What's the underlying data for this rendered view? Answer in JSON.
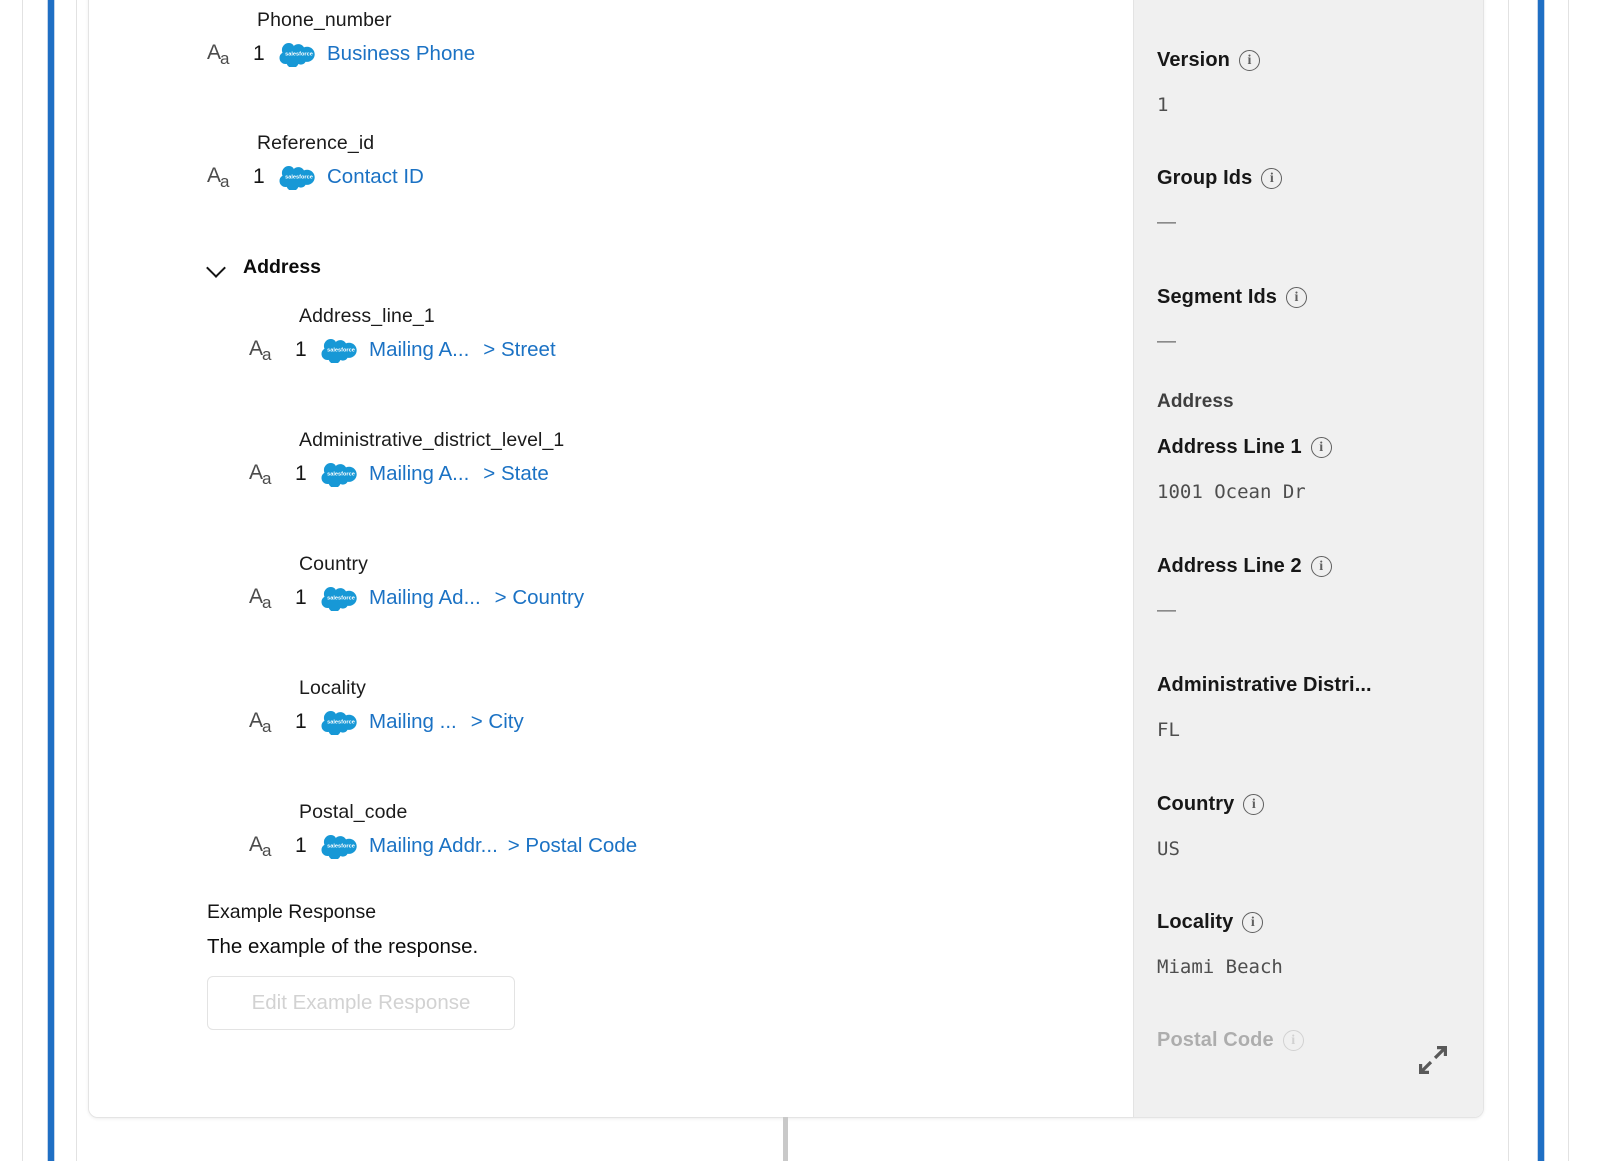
{
  "mapping_pane": {
    "fields": [
      {
        "name": "Phone_number",
        "type_icon": "text-type-icon",
        "count": "1",
        "source_icon": "salesforce-icon",
        "source": "Business Phone",
        "sub": ""
      },
      {
        "name": "Reference_id",
        "type_icon": "text-type-icon",
        "count": "1",
        "source_icon": "salesforce-icon",
        "source": "Contact ID",
        "sub": ""
      }
    ],
    "group": {
      "label": "Address",
      "expanded": true,
      "chevron_icon": "chevron-down-icon",
      "fields": [
        {
          "name": "Address_line_1",
          "count": "1",
          "source_icon": "salesforce-icon",
          "source": "Mailing A...",
          "sub": "> Street"
        },
        {
          "name": "Administrative_district_level_1",
          "count": "1",
          "source_icon": "salesforce-icon",
          "source": "Mailing A...",
          "sub": "> State"
        },
        {
          "name": "Country",
          "count": "1",
          "source_icon": "salesforce-icon",
          "source": "Mailing Ad...",
          "sub": "> Country"
        },
        {
          "name": "Locality",
          "count": "1",
          "source_icon": "salesforce-icon",
          "source": "Mailing ...",
          "sub": "> City"
        },
        {
          "name": "Postal_code",
          "count": "1",
          "source_icon": "salesforce-icon",
          "source": "Mailing Addr...",
          "sub": "> Postal Code"
        }
      ]
    },
    "example_response": {
      "title": "Example Response",
      "description": "The example of the response.",
      "button_label": "Edit Example Response"
    }
  },
  "detail_pane": {
    "expand_icon": "expand-diagonal-icon",
    "rows": [
      {
        "label": "Version",
        "has_info": true,
        "value": "1",
        "kind": "value"
      },
      {
        "label": "Group Ids",
        "has_info": true,
        "value": "—",
        "kind": "dash"
      },
      {
        "label": "Segment Ids",
        "has_info": true,
        "value": "—",
        "kind": "dash"
      },
      {
        "label": "Address",
        "has_info": false,
        "value": "",
        "kind": "section"
      },
      {
        "label": "Address Line 1",
        "has_info": true,
        "value": "1001 Ocean Dr",
        "kind": "value"
      },
      {
        "label": "Address Line 2",
        "has_info": true,
        "value": "—",
        "kind": "dash"
      },
      {
        "label": "Administrative Distri...",
        "has_info": false,
        "value": "FL",
        "kind": "value"
      },
      {
        "label": "Country",
        "has_info": true,
        "value": "US",
        "kind": "value"
      },
      {
        "label": "Locality",
        "has_info": true,
        "value": "Miami Beach",
        "kind": "value"
      },
      {
        "label": "Postal Code",
        "has_info": true,
        "value": "",
        "kind": "value"
      }
    ]
  },
  "colors": {
    "link": "#1b72c4",
    "rail": "#1f6fc4",
    "panel_bg": "#f0f0f0",
    "salesforce": "#00a1e0"
  }
}
